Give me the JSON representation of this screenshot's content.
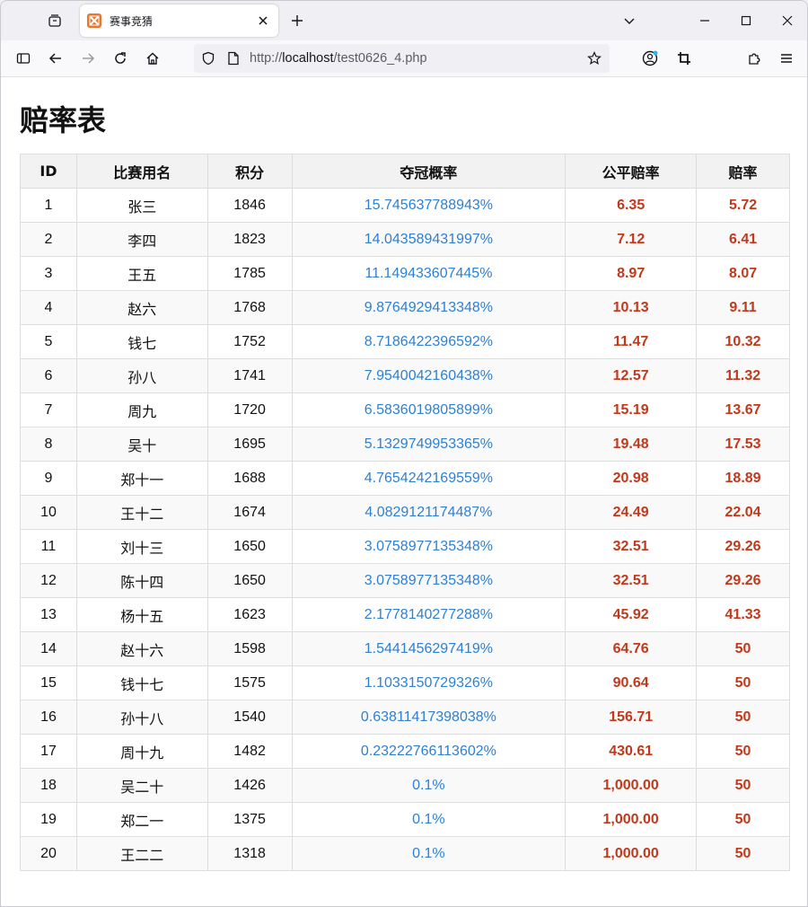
{
  "browser": {
    "tab_title": "赛事竞猜",
    "url_scheme": "http://",
    "url_host": "localhost",
    "url_path": "/test0626_4.php"
  },
  "page": {
    "title": "赔率表"
  },
  "table": {
    "headers": [
      "ID",
      "比赛用名",
      "积分",
      "夺冠概率",
      "公平赔率",
      "赔率"
    ],
    "rows": [
      {
        "id": "1",
        "name": "张三",
        "score": "1846",
        "prob": "15.745637788943%",
        "fair": "6.35",
        "odds": "5.72"
      },
      {
        "id": "2",
        "name": "李四",
        "score": "1823",
        "prob": "14.043589431997%",
        "fair": "7.12",
        "odds": "6.41"
      },
      {
        "id": "3",
        "name": "王五",
        "score": "1785",
        "prob": "11.149433607445%",
        "fair": "8.97",
        "odds": "8.07"
      },
      {
        "id": "4",
        "name": "赵六",
        "score": "1768",
        "prob": "9.8764929413348%",
        "fair": "10.13",
        "odds": "9.11"
      },
      {
        "id": "5",
        "name": "钱七",
        "score": "1752",
        "prob": "8.7186422396592%",
        "fair": "11.47",
        "odds": "10.32"
      },
      {
        "id": "6",
        "name": "孙八",
        "score": "1741",
        "prob": "7.9540042160438%",
        "fair": "12.57",
        "odds": "11.32"
      },
      {
        "id": "7",
        "name": "周九",
        "score": "1720",
        "prob": "6.5836019805899%",
        "fair": "15.19",
        "odds": "13.67"
      },
      {
        "id": "8",
        "name": "吴十",
        "score": "1695",
        "prob": "5.1329749953365%",
        "fair": "19.48",
        "odds": "17.53"
      },
      {
        "id": "9",
        "name": "郑十一",
        "score": "1688",
        "prob": "4.7654242169559%",
        "fair": "20.98",
        "odds": "18.89"
      },
      {
        "id": "10",
        "name": "王十二",
        "score": "1674",
        "prob": "4.0829121174487%",
        "fair": "24.49",
        "odds": "22.04"
      },
      {
        "id": "11",
        "name": "刘十三",
        "score": "1650",
        "prob": "3.0758977135348%",
        "fair": "32.51",
        "odds": "29.26"
      },
      {
        "id": "12",
        "name": "陈十四",
        "score": "1650",
        "prob": "3.0758977135348%",
        "fair": "32.51",
        "odds": "29.26"
      },
      {
        "id": "13",
        "name": "杨十五",
        "score": "1623",
        "prob": "2.1778140277288%",
        "fair": "45.92",
        "odds": "41.33"
      },
      {
        "id": "14",
        "name": "赵十六",
        "score": "1598",
        "prob": "1.5441456297419%",
        "fair": "64.76",
        "odds": "50"
      },
      {
        "id": "15",
        "name": "钱十七",
        "score": "1575",
        "prob": "1.1033150729326%",
        "fair": "90.64",
        "odds": "50"
      },
      {
        "id": "16",
        "name": "孙十八",
        "score": "1540",
        "prob": "0.63811417398038%",
        "fair": "156.71",
        "odds": "50"
      },
      {
        "id": "17",
        "name": "周十九",
        "score": "1482",
        "prob": "0.23222766113602%",
        "fair": "430.61",
        "odds": "50"
      },
      {
        "id": "18",
        "name": "吴二十",
        "score": "1426",
        "prob": "0.1%",
        "fair": "1,000.00",
        "odds": "50"
      },
      {
        "id": "19",
        "name": "郑二一",
        "score": "1375",
        "prob": "0.1%",
        "fair": "1,000.00",
        "odds": "50"
      },
      {
        "id": "20",
        "name": "王二二",
        "score": "1318",
        "prob": "0.1%",
        "fair": "1,000.00",
        "odds": "50"
      }
    ]
  },
  "colors": {
    "probability_text": "#2f80d1",
    "odds_text": "#c0391b",
    "favicon": "#e8772e"
  },
  "icons": {
    "tab_list": "tab-list-icon",
    "favicon": "xampp-favicon-icon",
    "close": "close-icon",
    "new_tab": "plus-icon",
    "list_all_tabs": "chevron-down-icon",
    "minimize": "minimize-icon",
    "maximize": "maximize-icon",
    "window_close": "window-close-icon",
    "sidebar": "sidebar-icon",
    "back": "back-arrow-icon",
    "forward": "forward-arrow-icon",
    "reload": "reload-icon",
    "home": "home-icon",
    "shield": "shield-icon",
    "page": "page-icon",
    "bookmark": "star-icon",
    "account": "account-icon",
    "screenshot": "crop-icon",
    "extensions": "puzzle-icon",
    "menu": "hamburger-menu-icon"
  }
}
